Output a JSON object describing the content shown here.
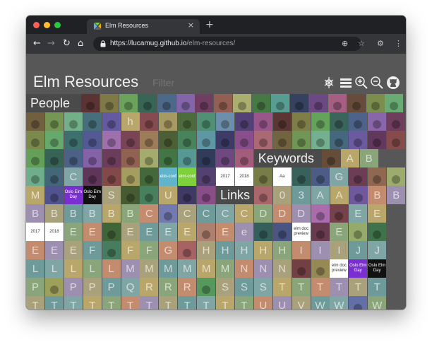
{
  "browser": {
    "tab_title": "Elm Resources",
    "tab_close": "×",
    "new_tab": "+",
    "url_host": "https://lucamug.github.io",
    "url_path": "/elm-resources/",
    "nav": {
      "back": "←",
      "forward": "→",
      "reload": "↻",
      "home": "⌂"
    },
    "toolbar_icons": {
      "zoom": "⊕",
      "star": "☆",
      "extension": "⚙",
      "menu": "⋮"
    }
  },
  "page": {
    "title": "Elm Resources",
    "filter_placeholder": "Filter",
    "header_icons": [
      "layout-switch-icon",
      "list-view-icon",
      "zoom-in-icon",
      "zoom-out-icon",
      "github-icon"
    ]
  },
  "sections": {
    "people": "People",
    "keywords": "Keywords",
    "links": "Links"
  },
  "tile_rows": [
    {
      "row": 1,
      "tiles": [
        "",
        "",
        "",
        "",
        "",
        "",
        "",
        "",
        "",
        "",
        "",
        "",
        "",
        "",
        "",
        "",
        "",
        "",
        ""
      ]
    },
    {
      "row": 2,
      "tiles": [
        "",
        "",
        "",
        "",
        "",
        "h",
        "",
        "",
        "",
        "",
        "",
        "",
        "",
        "",
        "",
        "",
        "",
        "",
        "",
        ""
      ]
    },
    {
      "row": 3,
      "tiles": [
        "",
        "",
        "",
        "",
        "",
        "",
        "",
        "",
        "",
        "",
        "",
        "",
        "",
        "",
        "",
        "",
        "",
        "",
        "",
        ""
      ]
    },
    {
      "row": 4,
      "tiles": [
        "",
        "",
        "",
        "",
        "",
        "",
        "",
        "",
        "",
        "",
        "",
        "",
        "",
        "A",
        "B"
      ]
    },
    {
      "row": 5,
      "tiles": [
        "",
        "",
        "C",
        "",
        "",
        "",
        "",
        "",
        "",
        "",
        "",
        "",
        "",
        "",
        "",
        "",
        "G",
        "",
        "",
        ""
      ]
    },
    {
      "row": 6,
      "tiles": [
        "M",
        "",
        "",
        "",
        "S",
        "",
        "",
        "U",
        "",
        "",
        "",
        "0",
        "3",
        "A",
        "A",
        "",
        "B",
        "B"
      ]
    },
    {
      "row": 7,
      "tiles": [
        "B",
        "B",
        "B",
        "B",
        "B",
        "B",
        "C",
        "",
        "C",
        "C",
        "C",
        "C",
        "D",
        "D",
        "D",
        "",
        "",
        "E",
        "E"
      ]
    },
    {
      "row": 8,
      "tiles": [
        "",
        "",
        "E",
        "E",
        "",
        "E",
        "E",
        "E",
        "E",
        "",
        "E",
        "e",
        "",
        "",
        "",
        "",
        "E",
        "",
        ""
      ]
    },
    {
      "row": 9,
      "tiles": [
        "E",
        "E",
        "E",
        "F",
        "",
        "F",
        "F",
        "G",
        "",
        "H",
        "H",
        "H",
        "H",
        "H",
        "I",
        "I",
        "I",
        "J",
        "J"
      ]
    },
    {
      "row": 10,
      "tiles": [
        "L",
        "L",
        "L",
        "L",
        "L",
        "M",
        "M",
        "M",
        "M",
        "M",
        "M",
        "N",
        "N",
        "N",
        "",
        "",
        "",
        ""
      ]
    },
    {
      "row": 11,
      "tiles": [
        "P",
        "",
        "P",
        "P",
        "P",
        "Q",
        "R",
        "R",
        "R",
        "",
        "S",
        "S",
        "S",
        "T",
        "T",
        "T",
        "T",
        "T",
        "T"
      ]
    },
    {
      "row": 12,
      "tiles": [
        "T",
        "T",
        "T",
        "T",
        "T",
        "T",
        "T",
        "T",
        "T",
        "T",
        "T",
        "T",
        "U",
        "U",
        "V",
        "W",
        "W",
        "",
        "W"
      ]
    }
  ],
  "logo_texts": {
    "oslo": "Oslo Elm Day",
    "elm_conf": "elm-conf",
    "year_2017": "2017",
    "year_2018": "2018",
    "elm_doc_preview": "elm doc preview",
    "aa": "Aa"
  },
  "colors": {
    "page_bg": "#575757",
    "tile_palette": [
      "#7fa6a4",
      "#b9a66a",
      "#8aa57a",
      "#c38c6e",
      "#9c8fb0",
      "#a9a17b",
      "#6f9a9a"
    ],
    "oslo_purple": "#7b2fd1",
    "elm_green": "#7fd13b",
    "elm_blue": "#60b5cc"
  }
}
